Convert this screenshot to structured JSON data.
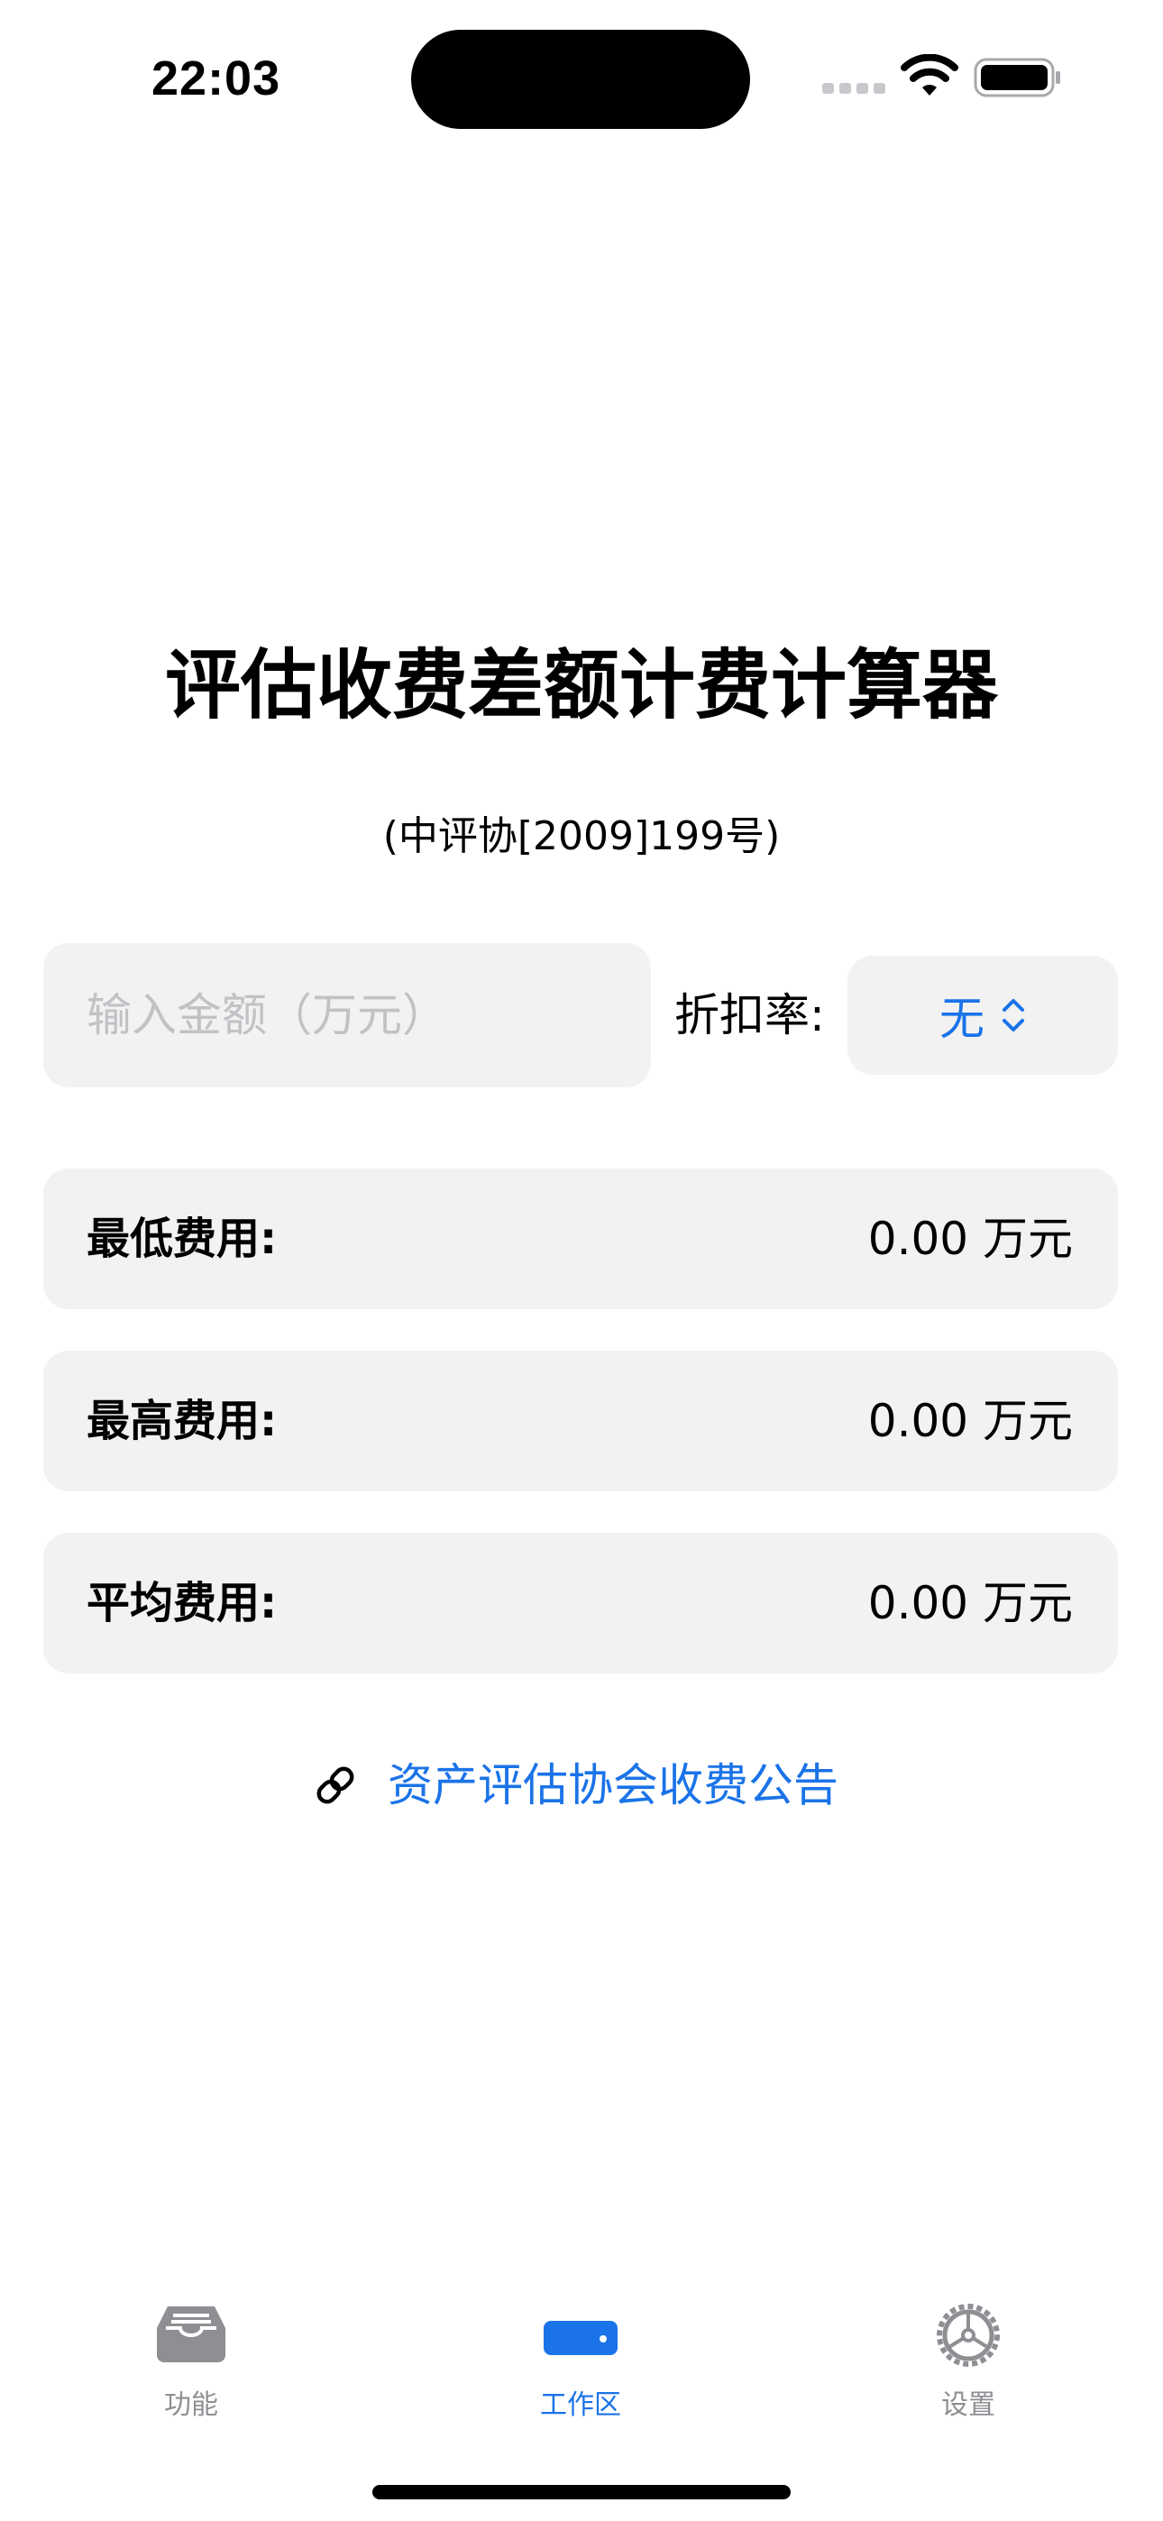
{
  "status_bar": {
    "time": "22:03"
  },
  "header": {
    "title": "评估收费差额计费计算器",
    "subtitle": "(中评协[2009]199号)"
  },
  "input": {
    "placeholder": "输入金额（万元）",
    "value": ""
  },
  "discount": {
    "label": "折扣率:",
    "selected": "无"
  },
  "results": {
    "min": {
      "label": "最低费用:",
      "value": "0.00 万元"
    },
    "max": {
      "label": "最高费用:",
      "value": "0.00 万元"
    },
    "avg": {
      "label": "平均费用:",
      "value": "0.00 万元"
    }
  },
  "link": {
    "text": "资产评估协会收费公告",
    "icon": "link-icon"
  },
  "tab_bar": {
    "tabs": [
      {
        "label": "功能",
        "icon": "tray-icon",
        "active": false
      },
      {
        "label": "工作区",
        "icon": "drive-icon",
        "active": true
      },
      {
        "label": "设置",
        "icon": "gear-icon",
        "active": false
      }
    ]
  },
  "colors": {
    "accent": "#1a73e8",
    "card_background": "#f2f2f2",
    "inactive_tab": "#8e8e93",
    "placeholder": "#c2c2c6"
  }
}
